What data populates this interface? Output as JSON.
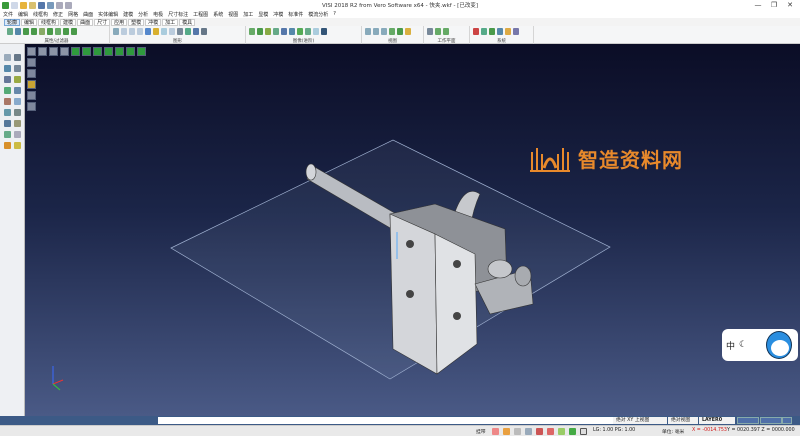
{
  "title": "VISI 2018 R2 from Vero Software x64 - 快夹.wkf - [已改变]",
  "window_controls": {
    "minimize": "—",
    "restore": "❐",
    "close": "✕"
  },
  "menu": [
    "文件",
    "编辑",
    "线框构",
    "修正",
    "网格",
    "曲面",
    "实体编辑",
    "建模",
    "分析",
    "电极",
    "尺寸标注",
    "工程图",
    "系统",
    "视图",
    "加工",
    "显模",
    "冲模",
    "标准件",
    "模流分析",
    "?"
  ],
  "tabs": [
    "轮廓",
    "编辑",
    "线框构",
    "建模",
    "曲面",
    "尺寸",
    "应用",
    "塑模",
    "冲模",
    "加工",
    "模具"
  ],
  "active_tab": "轮廓",
  "ribbon_groups": [
    "属性/过滤器",
    "图形",
    "图像(进阶)",
    "视图",
    "工作平面",
    "系统"
  ],
  "watermark": "智造资料网",
  "mascot_text": "中",
  "status": {
    "view_label": "绝对 XY 上视图",
    "absolute_view": "绝对视图",
    "layer": "LAYER0",
    "mode": "挂带",
    "scale": "LG: 1.00 PG: 1.00",
    "units": "单位: 毫米",
    "x": "X = -0014.753",
    "yz": "Y = 0020.397 Z = 0000.000"
  },
  "colors": {
    "accent": "#e8892b",
    "viewport_top": "#0b0d26",
    "viewport_bottom": "#4a5a86",
    "coord_x": "#d01818"
  }
}
